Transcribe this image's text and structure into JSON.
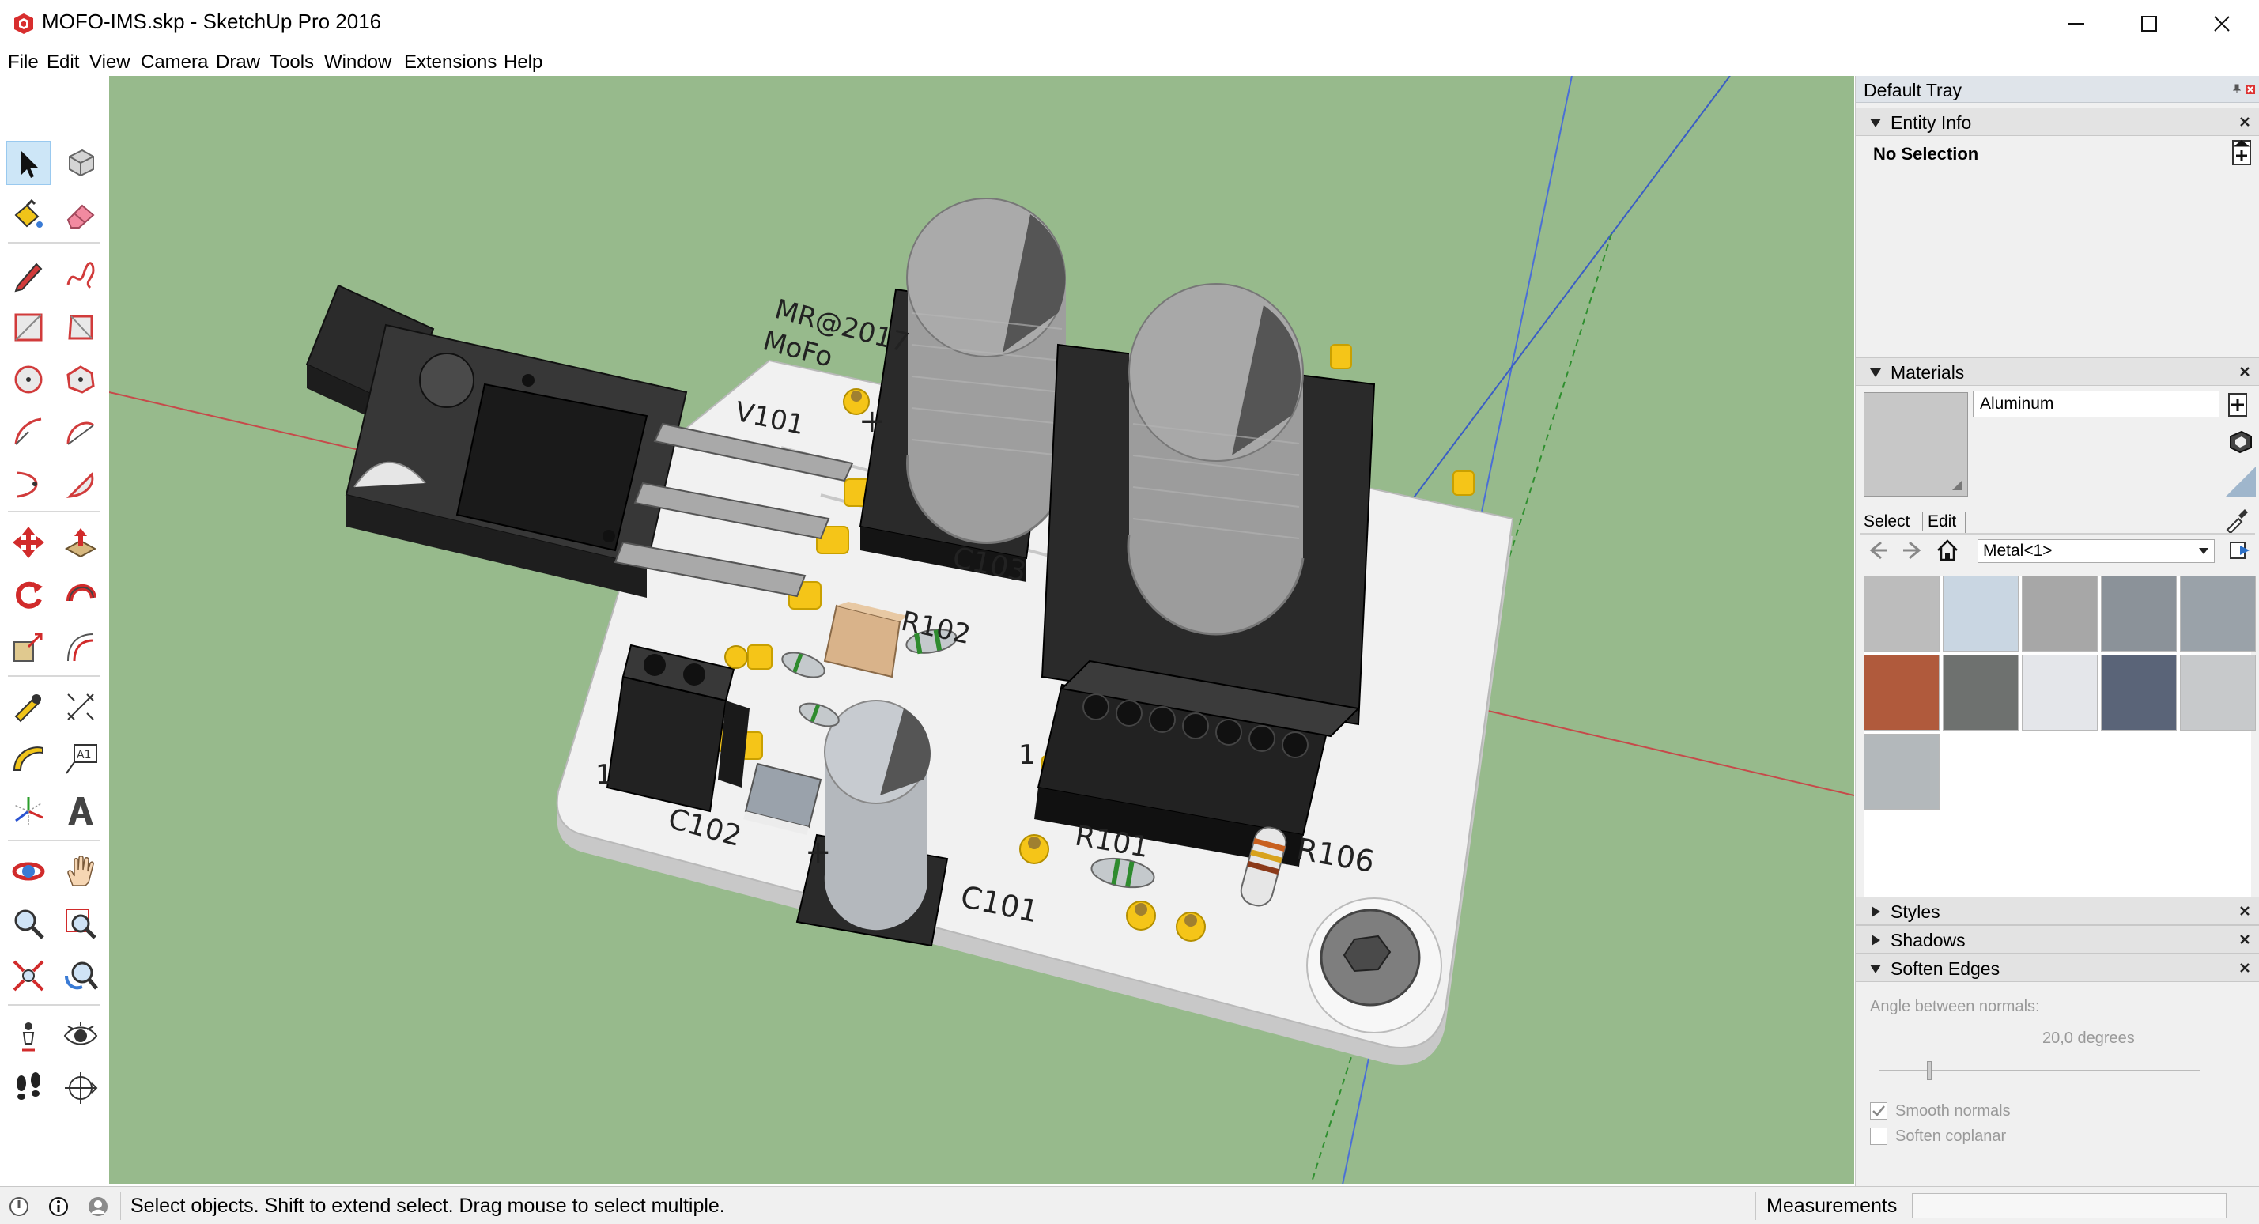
{
  "window": {
    "title": "MOFO-IMS.skp - SketchUp Pro 2016",
    "app_icon": "sketchup-logo-icon",
    "controls": [
      "minimize-icon",
      "maximize-icon",
      "close-icon"
    ]
  },
  "menu": {
    "file": "File",
    "edit": "Edit",
    "view": "View",
    "camera": "Camera",
    "draw": "Draw",
    "tools": "Tools",
    "window": "Window",
    "extensions": "Extensions",
    "help": "Help"
  },
  "toolbar": {
    "active_tool": "select",
    "tools": [
      "select",
      "make-component",
      "paint-bucket",
      "eraser",
      "line",
      "freehand",
      "rectangle",
      "rotated-rectangle",
      "circle",
      "polygon",
      "arc",
      "two-point-arc",
      "three-point-arc",
      "pie",
      "move",
      "push-pull",
      "rotate",
      "follow-me",
      "scale",
      "offset",
      "tape-measure",
      "dimension",
      "protractor",
      "text",
      "axes",
      "3d-text",
      "orbit",
      "pan",
      "zoom",
      "zoom-window",
      "zoom-extents",
      "previous-view",
      "position-camera",
      "look-around",
      "walk",
      "section-plane"
    ]
  },
  "model": {
    "silkscreen": {
      "credit": "MR@2017",
      "name": "MoFo",
      "v101": "V101",
      "r102": "R102",
      "c103": "C103",
      "c102": "C102",
      "c101": "C101",
      "r101": "R101",
      "r106": "R106",
      "pin1_left": "1",
      "pin1_right": "1",
      "plus_top": "+",
      "plus_bottom": "+"
    },
    "colors": {
      "background": "#97ba8c",
      "pcb": "#f1f1f1",
      "pads": "#f5c518",
      "components": "#262626",
      "capacitor": "#a9a9a9"
    }
  },
  "tray": {
    "title": "Default Tray",
    "entity_info": {
      "label": "Entity Info",
      "selection": "No Selection"
    },
    "materials": {
      "label": "Materials",
      "name": "Aluminum",
      "tab_select": "Select",
      "tab_edit": "Edit",
      "library": "Metal<1>",
      "swatch_colors": [
        "#bcbcbc",
        "#c9d6e2",
        "#a7a7a7",
        "#8b9299",
        "#9aa2a9",
        "#b05a3c",
        "#6e716f",
        "#e4e6ea",
        "#5a6478",
        "#c7c9cb",
        "#b3b8bb"
      ]
    },
    "styles": {
      "label": "Styles"
    },
    "shadows": {
      "label": "Shadows"
    },
    "soften_edges": {
      "label": "Soften Edges",
      "angle_label": "Angle between normals:",
      "angle_value": "20,0  degrees",
      "slider_value": 0.15,
      "smooth_normals": "Smooth normals",
      "smooth_checked": true,
      "soften_coplanar": "Soften coplanar",
      "coplanar_checked": false
    }
  },
  "status": {
    "text": "Select objects. Shift to extend select. Drag mouse to select multiple.",
    "measurements_label": "Measurements",
    "measurements_value": ""
  }
}
